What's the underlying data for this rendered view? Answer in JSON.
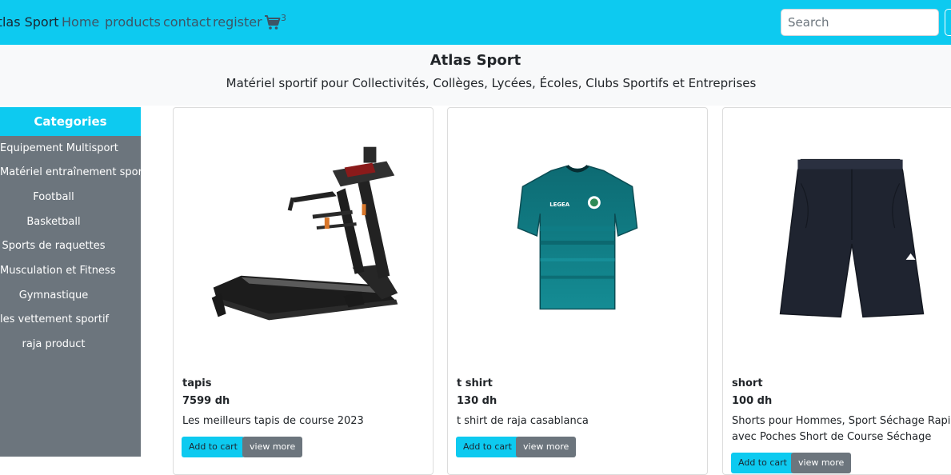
{
  "navbar": {
    "brand": "Atlas Sport",
    "links": [
      "Home",
      "products",
      "contact",
      "register"
    ],
    "cart_count": "3",
    "search_placeholder": "Search",
    "background": "#0dcaf0"
  },
  "header": {
    "title": "Atlas Sport",
    "subtitle": "Matériel sportif pour Collectivités, Collèges, Lycées, Écoles, Clubs Sportifs et Entreprises"
  },
  "sidebar": {
    "heading": "Categories",
    "items": [
      "Equipement Multisport",
      "Matériel entraînement sportif",
      "Football",
      "Basketball",
      "Sports de raquettes",
      "Musculation et Fitness",
      "Gymnastique",
      "les vettement sportif",
      "raja product"
    ]
  },
  "products": [
    {
      "name": "tapis",
      "price": "7599 dh",
      "description": "Les meilleurs tapis de course 2023",
      "image": "treadmill"
    },
    {
      "name": "t shirt",
      "price": "130 dh",
      "description": "t shirt de raja casablanca",
      "image": "teal-jersey"
    },
    {
      "name": "short",
      "price": "100 dh",
      "description": "Shorts pour Hommes, Sport Séchage Rapide avec Poches Short de Course Séchage",
      "image": "dark-shorts"
    }
  ],
  "buttons": {
    "add_to_cart": "Add to cart",
    "view_more": "view more"
  },
  "jersey_print": {
    "brand_text": "LEGEA"
  }
}
